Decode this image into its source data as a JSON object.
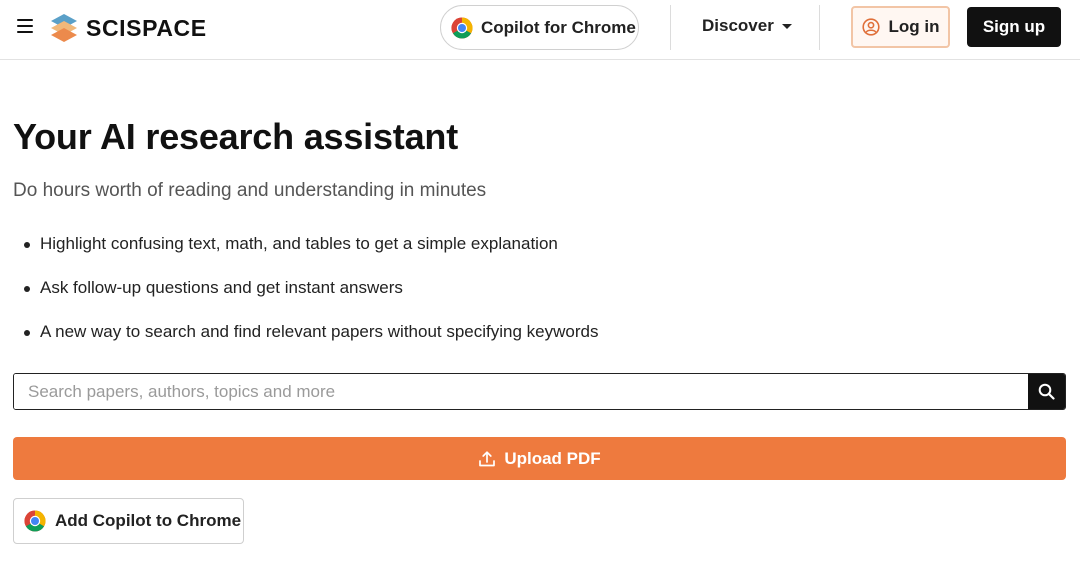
{
  "header": {
    "brand": "SCISPACE",
    "copilot_label": "Copilot for Chrome",
    "discover_label": "Discover",
    "login_label": "Log in",
    "signup_label": "Sign up"
  },
  "hero": {
    "title": "Your AI research assistant",
    "subtitle": "Do hours worth of reading and understanding in minutes",
    "features": [
      "Highlight confusing text, math, and tables to get a simple explanation",
      "Ask follow-up questions and get instant answers",
      "A new way to search and find relevant papers without specifying keywords"
    ]
  },
  "search": {
    "value": "",
    "placeholder": "Search papers, authors, topics and more"
  },
  "actions": {
    "upload_label": "Upload PDF",
    "add_copilot_label": "Add Copilot to Chrome"
  },
  "icons": {
    "menu": "hamburger-menu-icon",
    "logo": "scispace-logo-icon",
    "browser": "chrome-icon",
    "dropdown": "chevron-down-icon",
    "user": "user-circle-icon",
    "search": "search-icon",
    "upload": "upload-icon"
  },
  "colors": {
    "accent": "#ee7a3e",
    "dark": "#111111",
    "login_border": "#f2c5a6"
  }
}
